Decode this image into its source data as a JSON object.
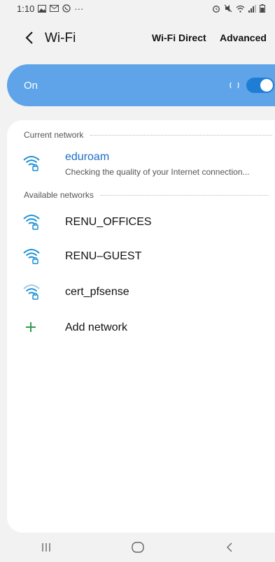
{
  "status_bar": {
    "time": "1:10",
    "left_icons": [
      "gallery-icon",
      "gmail-icon",
      "whatsapp-icon",
      "more-icon"
    ],
    "right_icons": [
      "alarm-icon",
      "mute-icon",
      "wifi-icon",
      "signal-icon",
      "battery-icon"
    ],
    "more": "···"
  },
  "header": {
    "title": "Wi-Fi",
    "wifi_direct_label": "Wi-Fi Direct",
    "advanced_label": "Advanced"
  },
  "toggle": {
    "label": "On",
    "state": "on",
    "accent_color": "#5fa4e8"
  },
  "current_network": {
    "section_label": "Current network",
    "name": "eduroam",
    "status": "Checking the quality of your Internet connection..."
  },
  "available_networks": {
    "section_label": "Available networks",
    "items": [
      {
        "name": "RENU_OFFICES",
        "icon": "wifi-locked-icon"
      },
      {
        "name": "RENU–GUEST",
        "icon": "wifi-locked-icon"
      },
      {
        "name": "cert_pfsense",
        "icon": "wifi-locked-icon"
      }
    ]
  },
  "add_network": {
    "label": "Add network"
  },
  "nav": {
    "buttons": [
      "recents-button",
      "home-button",
      "back-button"
    ]
  }
}
